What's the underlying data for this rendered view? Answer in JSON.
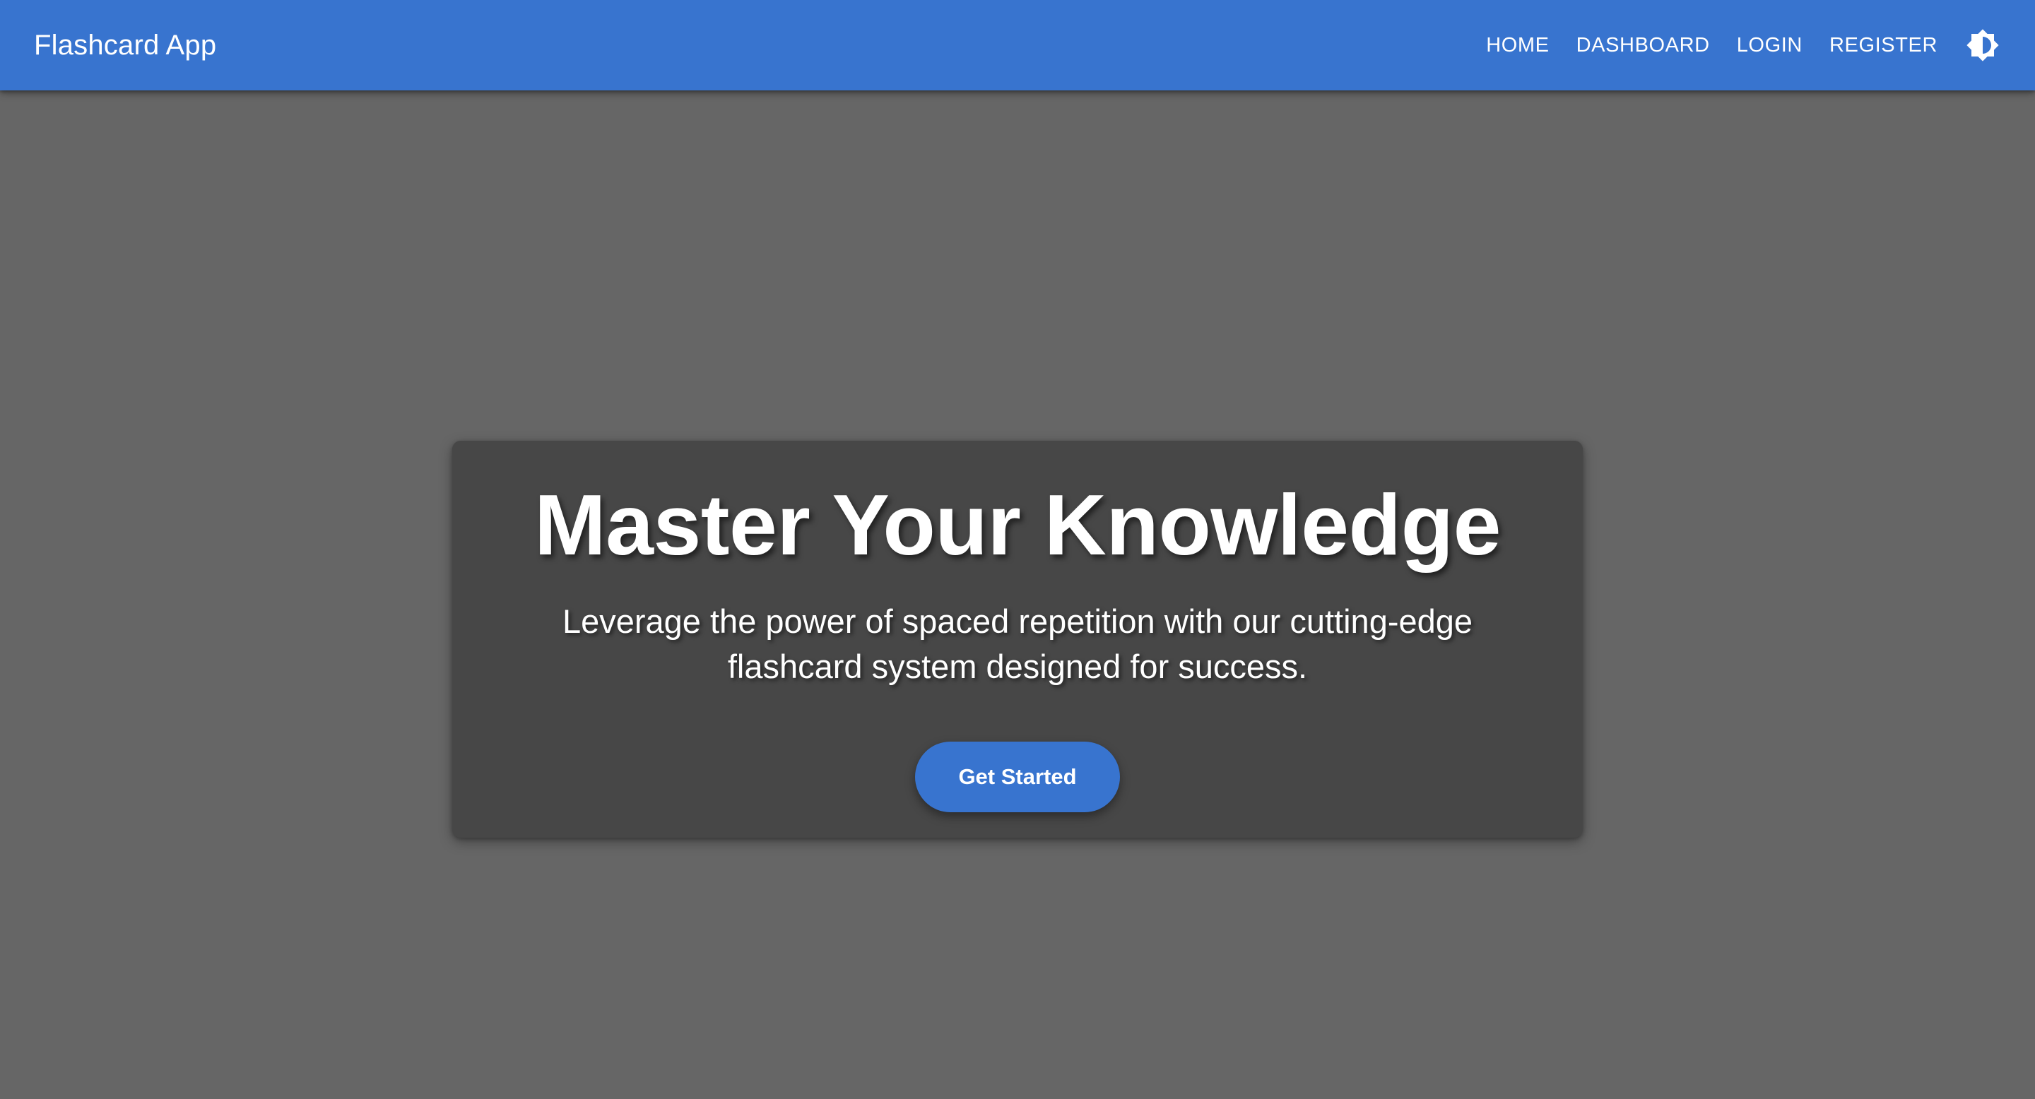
{
  "appbar": {
    "brand": "Flashcard App",
    "nav": [
      {
        "label": "HOME"
      },
      {
        "label": "DASHBOARD"
      },
      {
        "label": "LOGIN"
      },
      {
        "label": "REGISTER"
      }
    ],
    "theme_toggle_icon": "brightness-contrast-icon"
  },
  "hero": {
    "title": "Master Your Knowledge",
    "subtitle": "Leverage the power of spaced repetition with our cutting-edge flashcard system designed for success.",
    "cta_label": "Get Started"
  },
  "colors": {
    "primary": "#3874cf",
    "page_background": "#666666",
    "card_background": "#474747",
    "text": "#ffffff"
  }
}
